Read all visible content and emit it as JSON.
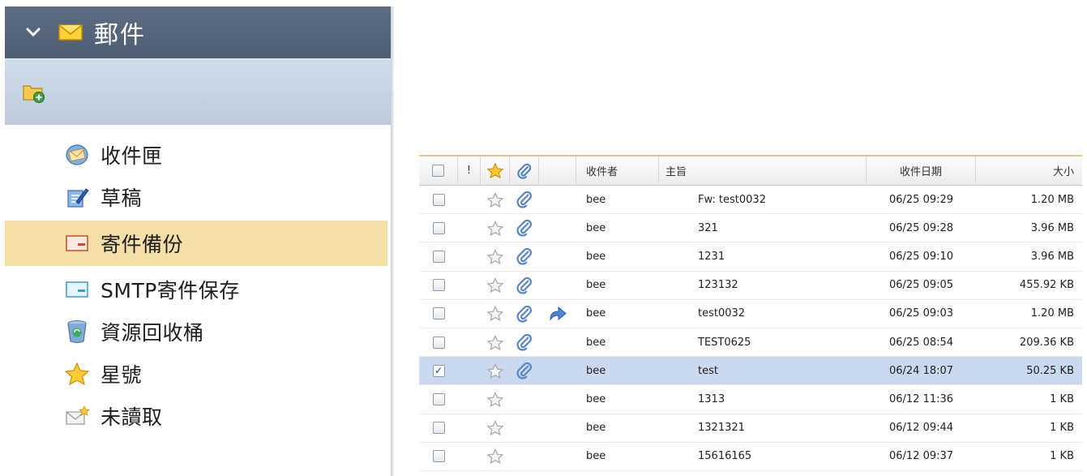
{
  "sidebar": {
    "title": "郵件",
    "folders": [
      {
        "label": "收件匣",
        "icon": "inbox-icon"
      },
      {
        "label": "草稿",
        "icon": "drafts-icon"
      },
      {
        "label": "寄件備份",
        "icon": "sent-icon",
        "active": true
      },
      {
        "label": "SMTP寄件保存",
        "icon": "smtp-sent-icon"
      },
      {
        "label": "資源回收桶",
        "icon": "recycle-bin-icon"
      },
      {
        "label": "星號",
        "icon": "star-icon"
      },
      {
        "label": "未讀取",
        "icon": "unread-icon"
      }
    ]
  },
  "grid": {
    "columns": {
      "flag": "!",
      "recipient": "收件者",
      "subject": "主旨",
      "date": "收件日期",
      "size": "大小"
    },
    "rows": [
      {
        "checked": false,
        "attachment": true,
        "forwarded": false,
        "recipient": "bee",
        "subject": "Fw: test0032",
        "date": "06/25 09:29",
        "size": "1.20 MB"
      },
      {
        "checked": false,
        "attachment": true,
        "forwarded": false,
        "recipient": "bee",
        "subject": "321",
        "date": "06/25 09:28",
        "size": "3.96 MB"
      },
      {
        "checked": false,
        "attachment": true,
        "forwarded": false,
        "recipient": "bee",
        "subject": "1231",
        "date": "06/25 09:10",
        "size": "3.96 MB"
      },
      {
        "checked": false,
        "attachment": true,
        "forwarded": false,
        "recipient": "bee",
        "subject": "123132",
        "date": "06/25 09:05",
        "size": "455.92 KB"
      },
      {
        "checked": false,
        "attachment": true,
        "forwarded": true,
        "recipient": "bee",
        "subject": "test0032",
        "date": "06/25 09:03",
        "size": "1.20 MB"
      },
      {
        "checked": false,
        "attachment": true,
        "forwarded": false,
        "recipient": "bee",
        "subject": "TEST0625",
        "date": "06/25 08:54",
        "size": "209.36 KB"
      },
      {
        "checked": true,
        "attachment": true,
        "forwarded": false,
        "recipient": "bee",
        "subject": "test",
        "date": "06/24 18:07",
        "size": "50.25 KB"
      },
      {
        "checked": false,
        "attachment": false,
        "forwarded": false,
        "recipient": "bee",
        "subject": "1313",
        "date": "06/12 11:36",
        "size": "1 KB"
      },
      {
        "checked": false,
        "attachment": false,
        "forwarded": false,
        "recipient": "bee",
        "subject": "1321321",
        "date": "06/12 09:44",
        "size": "1 KB"
      },
      {
        "checked": false,
        "attachment": false,
        "forwarded": false,
        "recipient": "bee",
        "subject": "15616165",
        "date": "06/12 09:37",
        "size": "1 KB"
      }
    ]
  },
  "colors": {
    "header_bg": "#56667b",
    "toolbar_bg": "#c5d3e3",
    "active_folder_bg": "#f4dfa6",
    "selected_row_bg": "#cad9ef",
    "header_accent": "#f0c48a"
  }
}
